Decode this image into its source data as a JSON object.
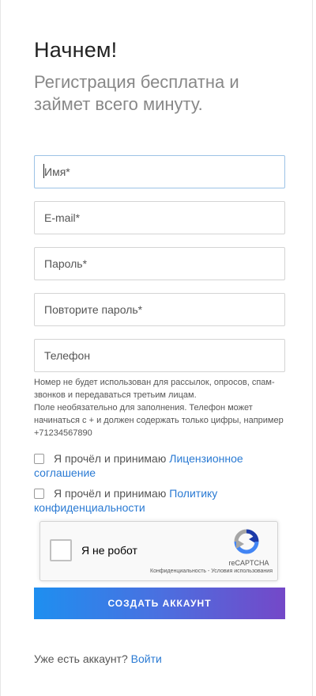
{
  "header": {
    "title": "Начнем!",
    "subtitle": "Регистрация бесплатна и займет всего минуту."
  },
  "form": {
    "name_placeholder": "Имя*",
    "email_placeholder": "E-mail*",
    "password_placeholder": "Пароль*",
    "password_repeat_placeholder": "Повторите пароль*",
    "phone_placeholder": "Телефон",
    "phone_hint_1": "Номер не будет использован для рассылок, опросов, спам-звонков и передаваться третьим лицам.",
    "phone_hint_2": "Поле необязательно для заполнения. Телефон может начинаться с + и должен содержать только цифры, например +71234567890"
  },
  "agreements": {
    "license_prefix": "Я прочёл и принимаю",
    "license_link": "Лицензионное соглашение",
    "privacy_prefix": "Я прочёл и принимаю",
    "privacy_link": "Политику конфиденциальности"
  },
  "recaptcha": {
    "label": "Я не робот",
    "brand": "reCAPTCHA",
    "privacy": "Конфиденциальность",
    "separator": " - ",
    "terms": "Условия использования"
  },
  "submit_label": "СОЗДАТЬ АККАУНТ",
  "footer": {
    "have_account": "Уже есть аккаунт?",
    "login_link": "Войти"
  },
  "colors": {
    "link": "#2a7ad3",
    "button_gradient_start": "#1e8ff0",
    "button_gradient_end": "#7448c8",
    "focused_border": "#9cc3e6"
  }
}
